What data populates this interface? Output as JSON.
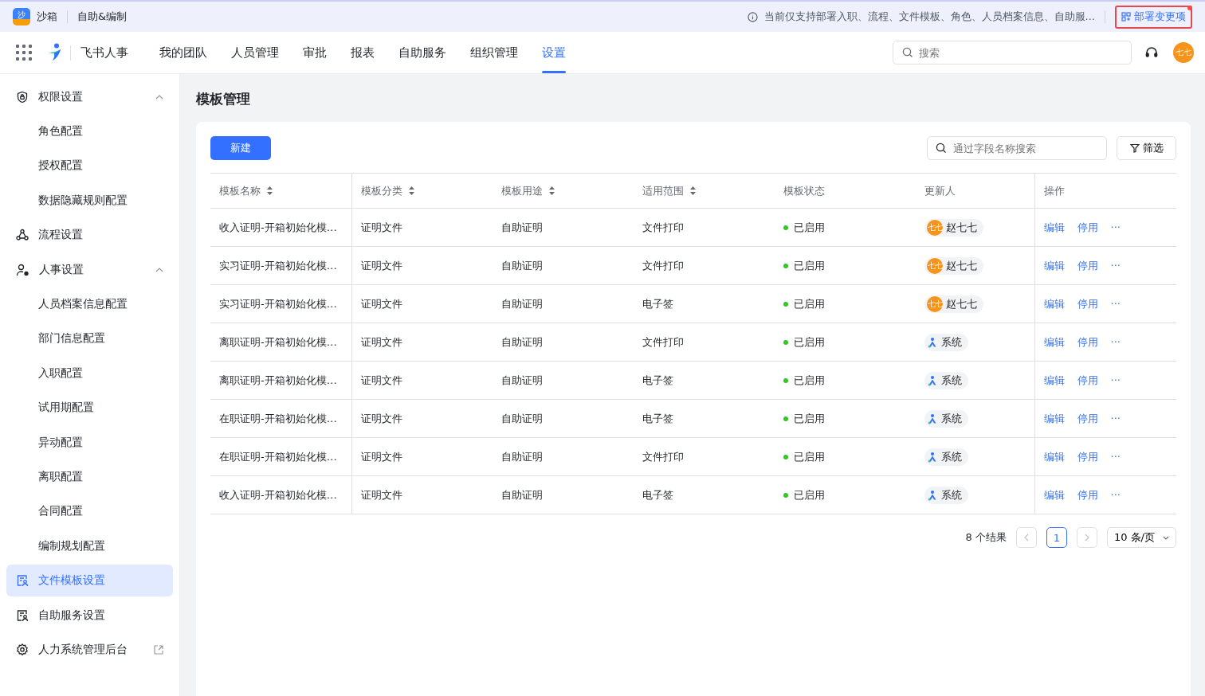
{
  "banner": {
    "app_badge": "沙",
    "app_name": "沙箱",
    "section": "自助&编制",
    "notice": "当前仅支持部署入职、流程、文件模板、角色、人员档案信息、自助服…",
    "deploy_link": "部署变更项",
    "deploy_unread": true
  },
  "navbar": {
    "product": "飞书人事",
    "tabs": [
      {
        "label": "我的团队",
        "selected": false
      },
      {
        "label": "人员管理",
        "selected": false
      },
      {
        "label": "审批",
        "selected": false
      },
      {
        "label": "报表",
        "selected": false
      },
      {
        "label": "自助服务",
        "selected": false
      },
      {
        "label": "组织管理",
        "selected": false
      },
      {
        "label": "设置",
        "selected": true
      }
    ],
    "search": {
      "placeholder": "搜索"
    },
    "avatar": "七七"
  },
  "sidebar": {
    "items": [
      {
        "label": "权限设置",
        "expanded": true,
        "selected": false,
        "children": [
          {
            "label": "角色配置",
            "selected": false
          },
          {
            "label": "授权配置",
            "selected": false
          },
          {
            "label": "数据隐藏规则配置",
            "selected": false
          }
        ]
      },
      {
        "label": "流程设置",
        "selected": false
      },
      {
        "label": "人事设置",
        "expanded": true,
        "selected": false,
        "children": [
          {
            "label": "人员档案信息配置",
            "selected": false
          },
          {
            "label": "部门信息配置",
            "selected": false
          },
          {
            "label": "入职配置",
            "selected": false
          },
          {
            "label": "试用期配置",
            "selected": false
          },
          {
            "label": "异动配置",
            "selected": false
          },
          {
            "label": "离职配置",
            "selected": false
          },
          {
            "label": "合同配置",
            "selected": false
          },
          {
            "label": "编制规划配置",
            "selected": false
          }
        ]
      },
      {
        "label": "文件模板设置",
        "selected": true
      },
      {
        "label": "自助服务设置",
        "selected": false
      },
      {
        "label": "人力系统管理后台",
        "selected": false,
        "external": true
      }
    ]
  },
  "page_title": "模板管理",
  "toolbar": {
    "new_button": "新建",
    "search": {
      "placeholder": "通过字段名称搜索"
    },
    "filter_button": "筛选"
  },
  "table": {
    "columns": [
      {
        "label": "模板名称",
        "sortable": true
      },
      {
        "label": "模板分类",
        "sortable": true
      },
      {
        "label": "模板用途",
        "sortable": true
      },
      {
        "label": "适用范围",
        "sortable": true
      },
      {
        "label": "模板状态",
        "sortable": false
      },
      {
        "label": "更新人",
        "sortable": false
      },
      {
        "label": "操作",
        "sortable": false
      }
    ],
    "rows": [
      {
        "name": "收入证明-开箱初始化模…",
        "category": "证明文件",
        "usage": "自助证明",
        "scope": "文件打印",
        "status": "已启用",
        "updater": {
          "kind": "person",
          "avatar": "七七",
          "name": "赵七七"
        },
        "actions": [
          "编辑",
          "停用",
          "···"
        ]
      },
      {
        "name": "实习证明-开箱初始化模…",
        "category": "证明文件",
        "usage": "自助证明",
        "scope": "文件打印",
        "status": "已启用",
        "updater": {
          "kind": "person",
          "avatar": "七七",
          "name": "赵七七"
        },
        "actions": [
          "编辑",
          "停用",
          "···"
        ]
      },
      {
        "name": "实习证明-开箱初始化模…",
        "category": "证明文件",
        "usage": "自助证明",
        "scope": "电子签",
        "status": "已启用",
        "updater": {
          "kind": "person",
          "avatar": "七七",
          "name": "赵七七"
        },
        "actions": [
          "编辑",
          "停用",
          "···"
        ]
      },
      {
        "name": "离职证明-开箱初始化模…",
        "category": "证明文件",
        "usage": "自助证明",
        "scope": "文件打印",
        "status": "已启用",
        "updater": {
          "kind": "system",
          "name": "系统"
        },
        "actions": [
          "编辑",
          "停用",
          "···"
        ]
      },
      {
        "name": "离职证明-开箱初始化模…",
        "category": "证明文件",
        "usage": "自助证明",
        "scope": "电子签",
        "status": "已启用",
        "updater": {
          "kind": "system",
          "name": "系统"
        },
        "actions": [
          "编辑",
          "停用",
          "···"
        ]
      },
      {
        "name": "在职证明-开箱初始化模…",
        "category": "证明文件",
        "usage": "自助证明",
        "scope": "电子签",
        "status": "已启用",
        "updater": {
          "kind": "system",
          "name": "系统"
        },
        "actions": [
          "编辑",
          "停用",
          "···"
        ]
      },
      {
        "name": "在职证明-开箱初始化模…",
        "category": "证明文件",
        "usage": "自助证明",
        "scope": "文件打印",
        "status": "已启用",
        "updater": {
          "kind": "system",
          "name": "系统"
        },
        "actions": [
          "编辑",
          "停用",
          "···"
        ]
      },
      {
        "name": "收入证明-开箱初始化模…",
        "category": "证明文件",
        "usage": "自助证明",
        "scope": "电子签",
        "status": "已启用",
        "updater": {
          "kind": "system",
          "name": "系统"
        },
        "actions": [
          "编辑",
          "停用",
          "···"
        ]
      }
    ]
  },
  "pagination": {
    "total": "8 个结果",
    "pages": [
      {
        "label": "1",
        "selected": true
      }
    ],
    "page_size": "10 条/页"
  }
}
